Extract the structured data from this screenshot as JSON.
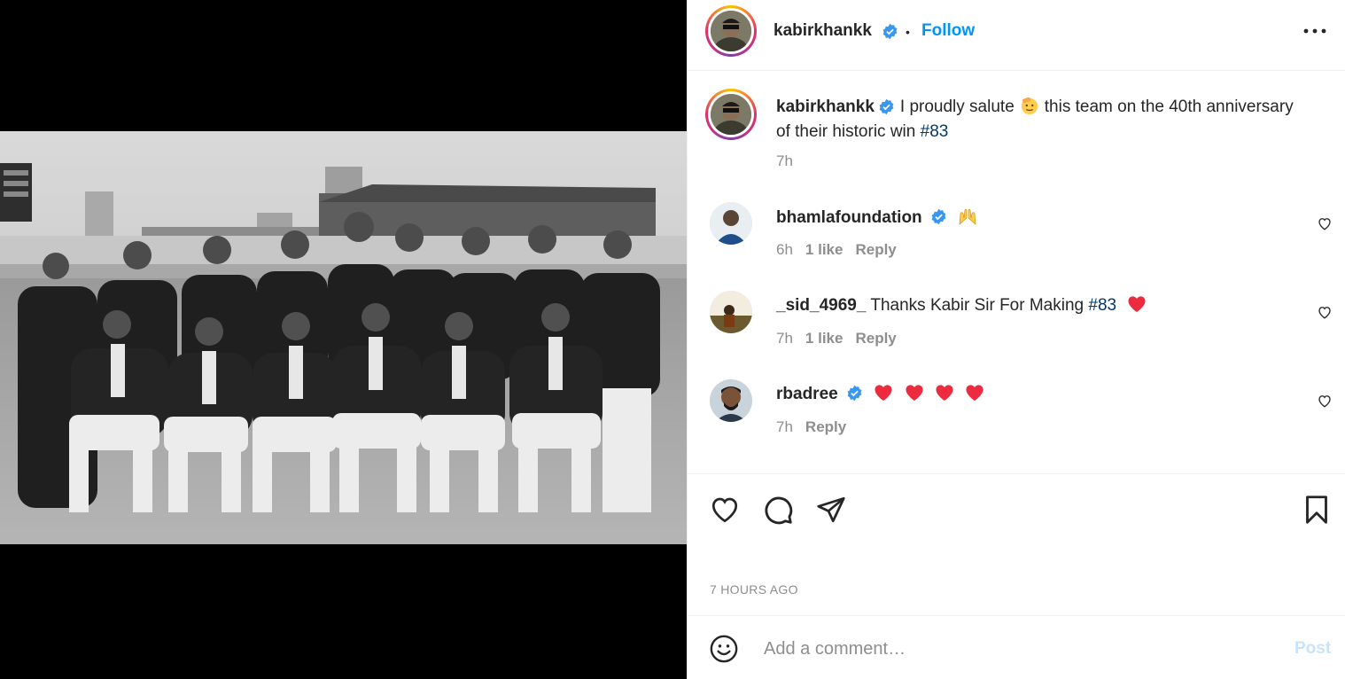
{
  "post": {
    "image_alt": "Black and white team photograph of a cricket team in blazers on a stadium field",
    "author": "kabirkhankk",
    "follow_label": "Follow",
    "separator": "•",
    "caption": {
      "username": "kabirkhankk",
      "text_before_emoji": "I proudly salute",
      "text_after_emoji": "this team on the 40th anniversary of their historic win",
      "hashtag": "#83",
      "time": "7h"
    },
    "comments": [
      {
        "username": "bhamlafoundation",
        "verified": true,
        "text": "",
        "emoji": "raising-hands",
        "time": "6h",
        "likes": "1 like",
        "reply_label": "Reply"
      },
      {
        "username": "_sid_4969_",
        "verified": false,
        "text": "Thanks Kabir Sir For Making",
        "hashtag": "#83",
        "emoji": "red-heart",
        "time": "7h",
        "likes": "1 like",
        "reply_label": "Reply"
      },
      {
        "username": "rbadree",
        "verified": true,
        "text": "",
        "emoji": "red-heart x4",
        "time": "7h",
        "likes": "",
        "reply_label": "Reply"
      }
    ],
    "timestamp": "7 HOURS AGO",
    "comment_placeholder": "Add a comment…",
    "post_label": "Post"
  },
  "icons": {
    "like": "heart-outline-icon",
    "comment": "speech-bubble-icon",
    "share": "paper-plane-icon",
    "save": "bookmark-icon",
    "emoji": "smiley-icon",
    "more": "ellipsis-icon",
    "verified": "verified-badge-icon"
  },
  "colors": {
    "accent": "#0095f6",
    "verified": "#3897f0",
    "hashtag": "#00376b",
    "meta": "#8e8e8e",
    "heart": "#ed2b3f",
    "post_disabled": "#c7e4fd"
  }
}
